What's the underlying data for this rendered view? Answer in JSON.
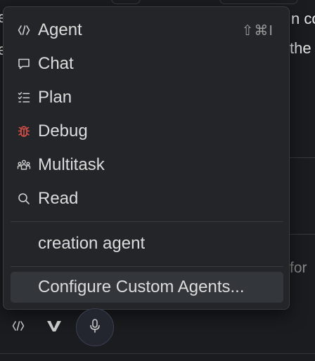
{
  "background": {
    "fragment_top_right_1": "n co",
    "fragment_top_right_2": "the",
    "fragment_for": "for",
    "fragment_left_1": "e",
    "fragment_left_2": "e"
  },
  "menu": {
    "items": [
      {
        "label": "Agent",
        "icon": "agent-icon",
        "shortcut": "⇧⌘I"
      },
      {
        "label": "Chat",
        "icon": "chat-icon"
      },
      {
        "label": "Plan",
        "icon": "plan-list-icon"
      },
      {
        "label": "Debug",
        "icon": "bug-icon",
        "icon_color": "#e0514a"
      },
      {
        "label": "Multitask",
        "icon": "multitask-icon"
      },
      {
        "label": "Read",
        "icon": "search-icon"
      }
    ],
    "custom_agent": {
      "label": "creation agent"
    },
    "configure": {
      "label": "Configure Custom Agents..."
    }
  },
  "toolbar": {
    "icons": [
      "agent-icon",
      "v-logo-icon",
      "microphone-icon"
    ]
  },
  "colors": {
    "menu_bg": "#242528",
    "highlight_bg": "#33363b",
    "debug_red": "#e0514a",
    "page_bg": "#1b1c1f"
  }
}
